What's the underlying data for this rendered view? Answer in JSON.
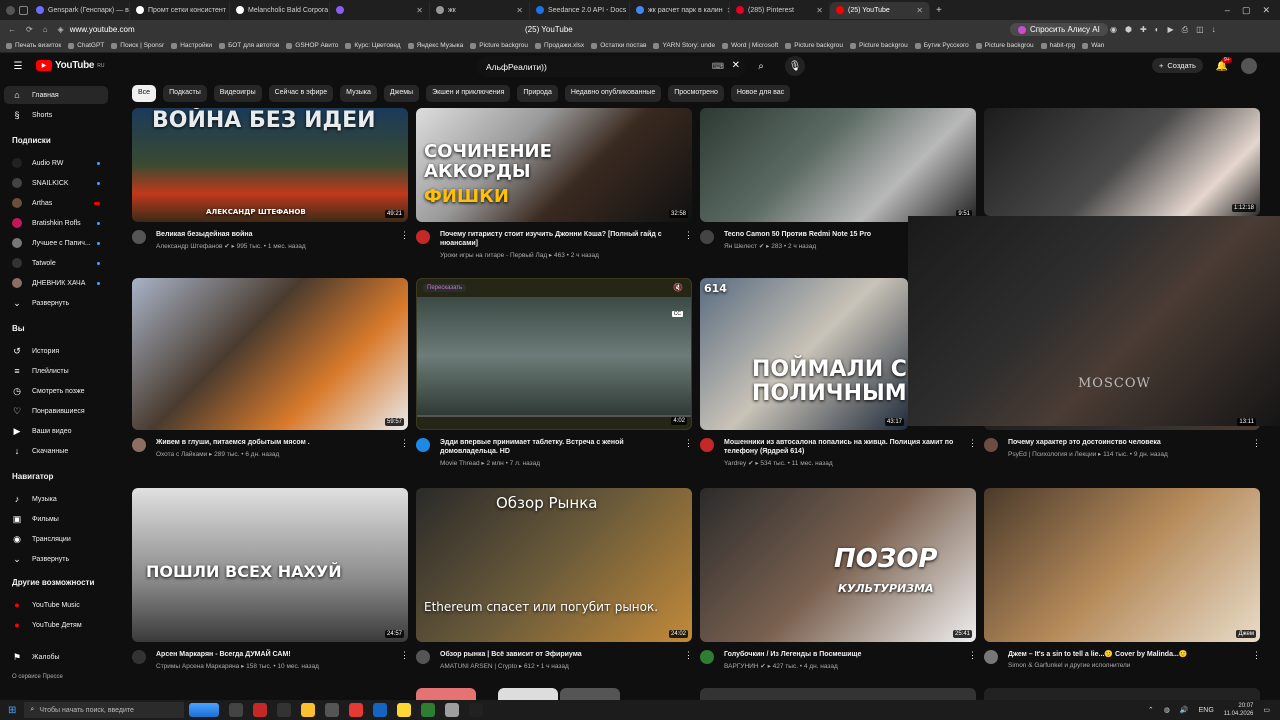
{
  "browser": {
    "tabs": [
      {
        "title": "Genspark (Генспарк) — в",
        "color": "#6c6cff"
      },
      {
        "title": "Промт сетки консистент",
        "color": "#ffffff"
      },
      {
        "title": "Melancholic Bald Corpora",
        "color": "#ffffff"
      },
      {
        "title": "",
        "color": "#8b5cf6"
      },
      {
        "title": "жк",
        "color": "#999999"
      },
      {
        "title": "Seedance 2.0 API - Docs",
        "color": "#1a73e8"
      },
      {
        "title": "жк расчет парк в калин",
        "color": "#4285f4"
      },
      {
        "title": "(285) Pinterest",
        "color": "#e60023"
      },
      {
        "title": "(25) YouTube",
        "color": "#ff0000"
      }
    ],
    "new_tab": "+",
    "url": "www.youtube.com",
    "page_title": "(25) YouTube",
    "alice_button": "Спросить Алису AI",
    "bookmarks": [
      "Печать визиток",
      "ChatGPT",
      "Поиск | Sponsr",
      "Настройки",
      "БОТ для автотов",
      "GSHOP Авито",
      "Курс: Цветовед",
      "Яндекс Музыка",
      "Picture backgrou",
      "Продажи.xlsx",
      "Остатки постав",
      "YARN Story: unde",
      "Word | Microsoft",
      "Picture backgrou",
      "Picture backgrou",
      "Бутик Русского",
      "Picture backgrou",
      "habit-rpg",
      "Wan"
    ]
  },
  "header": {
    "logo": "YouTube",
    "logo_region": "RU",
    "search_value": "АльфРеалити))",
    "create_label": "Создать",
    "notif_badge": "9+"
  },
  "chips": [
    "Все",
    "Подкасты",
    "Видеоигры",
    "Сейчас в эфире",
    "Музыка",
    "Джемы",
    "Экшен и приключения",
    "Природа",
    "Недавно опубликованные",
    "Просмотрено",
    "Новое для вас"
  ],
  "sidebar": {
    "main": [
      {
        "label": "Главная",
        "icon": "home-icon",
        "glyph": "⌂"
      },
      {
        "label": "Shorts",
        "icon": "shorts-icon",
        "glyph": "§"
      }
    ],
    "subs_title": "Подписки",
    "subs": [
      {
        "label": "Audio RW",
        "color": "#222222",
        "dot": true
      },
      {
        "label": "SNAILKICK",
        "color": "#444444",
        "dot": true
      },
      {
        "label": "Arthas",
        "color": "#6b4f3a",
        "dot": false,
        "live": true
      },
      {
        "label": "Bratishkin Rofls",
        "color": "#c2185b",
        "dot": true
      },
      {
        "label": "Лучшее с Папич...",
        "color": "#777777",
        "dot": true
      },
      {
        "label": "Tatwole",
        "color": "#333333",
        "dot": true
      },
      {
        "label": "ДНЕВНИК ХАЧА",
        "color": "#8d6e63",
        "dot": true
      }
    ],
    "expand_label": "Развернуть",
    "you_title": "Вы",
    "you": [
      {
        "label": "История",
        "glyph": "↺"
      },
      {
        "label": "Плейлисты",
        "glyph": "≡"
      },
      {
        "label": "Смотреть позже",
        "glyph": "◷"
      },
      {
        "label": "Понравившиеся",
        "glyph": "♡"
      },
      {
        "label": "Ваши видео",
        "glyph": "▶"
      },
      {
        "label": "Скачанные",
        "glyph": "↓"
      }
    ],
    "nav_title": "Навигатор",
    "nav": [
      {
        "label": "Музыка",
        "glyph": "♪"
      },
      {
        "label": "Фильмы",
        "glyph": "▣"
      },
      {
        "label": "Трансляции",
        "glyph": "◉"
      },
      {
        "label": "Развернуть",
        "glyph": "⌄"
      }
    ],
    "more_title": "Другие возможности",
    "more": [
      {
        "label": "YouTube Music"
      },
      {
        "label": "YouTube Детям"
      }
    ],
    "report": "Жалобы",
    "footer": "О сервисе  Прессе"
  },
  "videos": [
    {
      "title": "Великая безыдейная война",
      "channel": "Александр Штефанов",
      "verified": true,
      "views": "995 тыс.",
      "age": "1 мес. назад",
      "duration": "49:21",
      "thumb_text": "ВОЙНА БЕЗ ИДЕИ",
      "thumb_sub": "АЛЕКСАНДР ШТЕФАНОВ"
    },
    {
      "title": "Почему гитаристу стоит изучить Джонни Кэша? [Полный гайд с нюансами]",
      "channel": "Уроки игры на гитаре - Первый Лад",
      "verified": false,
      "views": "463",
      "age": "2 ч назад",
      "duration": "32:58",
      "thumb_text": "СОЧИНЕНИЕ АККОРДЫ",
      "thumb_sub": "ФИШКИ"
    },
    {
      "title": "Tecno Camon 50 Против Redmi Note 15 Pro",
      "channel": "Ян Шелест",
      "verified": true,
      "views": "283",
      "age": "2 ч назад",
      "duration": "9:51"
    },
    {
      "title": "",
      "channel": "",
      "verified": false,
      "views": "",
      "age": "",
      "duration": "1:12:18"
    },
    {
      "title": "Живем в глуши, питаемся добытым мясом .",
      "channel": "Охота с Лайками",
      "verified": false,
      "views": "289 тыс.",
      "age": "6 дн. назад",
      "duration": "59:57"
    },
    {
      "title": "Эдди впервые принимает таблетку. Встреча с женой домовладельца. HD",
      "channel": "Movie Thread",
      "verified": false,
      "views": "2 млн",
      "age": "7 л. назад",
      "duration": "4:02",
      "rewatch": "Пересказать",
      "cc": "CC"
    },
    {
      "title": "Мошенники из автосалона попались на живца. Полиция хамит по телефону (Ярдрей 614)",
      "channel": "Yardrey",
      "verified": true,
      "views": "534 тыс.",
      "age": "11 мес. назад",
      "duration": "43:17",
      "thumb_text": "ПОЙМАЛИ С ПОЛИЧНЫМ",
      "badge": "614"
    },
    {
      "title": "Почему характер это достоинство человека",
      "channel": "PsyEd | Психология и Лекции",
      "verified": false,
      "views": "114 тыс.",
      "age": "9 дн. назад",
      "duration": "13:11",
      "shirt_text": "MOSCOW"
    },
    {
      "title": "Арсен Маркарян - Всегда ДУМАЙ САМ!",
      "channel": "Стримы Арсена Маркаряна",
      "verified": false,
      "views": "158 тыс.",
      "age": "10 мес. назад",
      "duration": "24:57",
      "thumb_text": "ПОШЛИ ВСЕХ НАХУЙ"
    },
    {
      "title": "Обзор рынка | Всё зависит от Эфириума",
      "channel": "AMATUNI ARSEN | Crypto",
      "verified": false,
      "views": "612",
      "age": "1 ч назад",
      "duration": "24:02",
      "thumb_text": "Обзор Рынка",
      "thumb_sub": "Ethereum спасет или погубит рынок."
    },
    {
      "title": "Голубочкин / Из Легенды в Посмешище",
      "channel": "ВАРГУНИН",
      "verified": true,
      "views": "427 тыс.",
      "age": "4 дн. назад",
      "duration": "25:41",
      "thumb_text": "ПОЗОР",
      "thumb_sub": "КУЛЬТУРИЗМА"
    },
    {
      "title": "Джем – It's a sin to tell a lie...🙂 Cover by Malinda...🙂",
      "channel": "Simon & Garfunkel и другие исполнители",
      "verified": false,
      "views": "",
      "age": "",
      "duration": "Джем"
    }
  ],
  "taskbar": {
    "search_placeholder": "Чтобы начать поиск, введите",
    "lang": "ENG",
    "time": "20:07",
    "date": "11.04.2026"
  }
}
